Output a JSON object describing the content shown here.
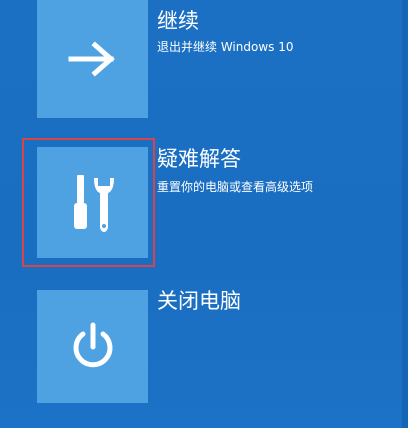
{
  "options": [
    {
      "title": "继续",
      "desc": "退出并继续 Windows 10",
      "icon": "arrow-right-icon"
    },
    {
      "title": "疑难解答",
      "desc": "重置你的电脑或查看高级选项",
      "icon": "tools-icon"
    },
    {
      "title": "关闭电脑",
      "icon": "power-icon"
    }
  ],
  "colors": {
    "background": "#1a6fc3",
    "tile": "#4ea2e1",
    "highlight": "#d9434a"
  }
}
